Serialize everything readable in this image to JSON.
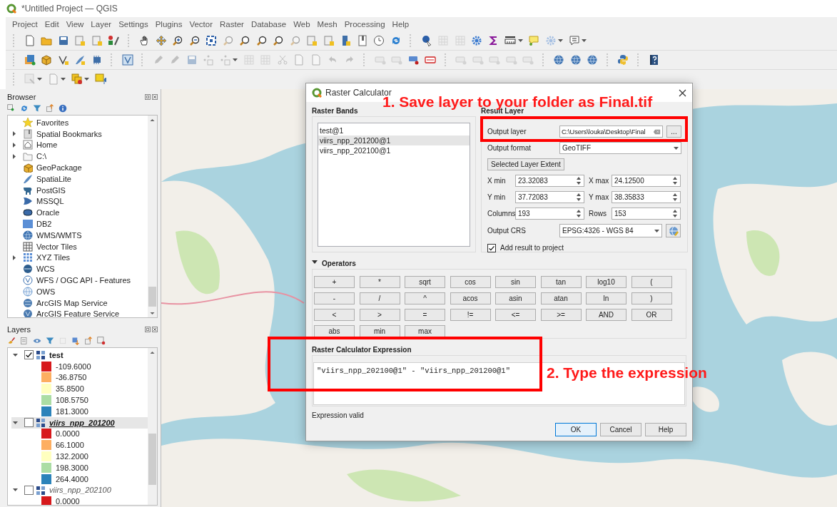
{
  "window": {
    "title": "*Untitled Project — QGIS"
  },
  "menu": [
    "Project",
    "Edit",
    "View",
    "Layer",
    "Settings",
    "Plugins",
    "Vector",
    "Raster",
    "Database",
    "Web",
    "Mesh",
    "Processing",
    "Help"
  ],
  "browser": {
    "title": "Browser",
    "items": [
      {
        "label": "Favorites",
        "kind": "leaf"
      },
      {
        "label": "Spatial Bookmarks",
        "kind": "group"
      },
      {
        "label": "Home",
        "kind": "group"
      },
      {
        "label": "C:\\",
        "kind": "group"
      },
      {
        "label": "GeoPackage",
        "kind": "leaf"
      },
      {
        "label": "SpatiaLite",
        "kind": "leaf"
      },
      {
        "label": "PostGIS",
        "kind": "leaf"
      },
      {
        "label": "MSSQL",
        "kind": "leaf"
      },
      {
        "label": "Oracle",
        "kind": "leaf"
      },
      {
        "label": "DB2",
        "kind": "leaf"
      },
      {
        "label": "WMS/WMTS",
        "kind": "leaf"
      },
      {
        "label": "Vector Tiles",
        "kind": "leaf"
      },
      {
        "label": "XYZ Tiles",
        "kind": "group"
      },
      {
        "label": "WCS",
        "kind": "leaf"
      },
      {
        "label": "WFS / OGC API - Features",
        "kind": "leaf"
      },
      {
        "label": "OWS",
        "kind": "leaf"
      },
      {
        "label": "ArcGIS Map Service",
        "kind": "leaf"
      },
      {
        "label": "ArcGIS Feature Service",
        "kind": "leaf"
      }
    ]
  },
  "layers": {
    "title": "Layers",
    "items": [
      {
        "name": "test",
        "checked": true,
        "expanded": true,
        "selected": false,
        "legend": [
          {
            "label": "-109.6000",
            "color": "#d7191c"
          },
          {
            "label": "-36.8750",
            "color": "#fdae61"
          },
          {
            "label": "35.8500",
            "color": "#ffffbf"
          },
          {
            "label": "108.5750",
            "color": "#abdda4"
          },
          {
            "label": "181.3000",
            "color": "#2b83ba"
          }
        ]
      },
      {
        "name": "viirs_npp_201200",
        "checked": false,
        "expanded": true,
        "selected": true,
        "legend": [
          {
            "label": "0.0000",
            "color": "#d7191c"
          },
          {
            "label": "66.1000",
            "color": "#fdae61"
          },
          {
            "label": "132.2000",
            "color": "#ffffbf"
          },
          {
            "label": "198.3000",
            "color": "#abdda4"
          },
          {
            "label": "264.4000",
            "color": "#2b83ba"
          }
        ]
      },
      {
        "name": "viirs_npp_202100",
        "checked": false,
        "expanded": true,
        "selected": false,
        "legend": [
          {
            "label": "0.0000",
            "color": "#d7191c"
          }
        ]
      }
    ]
  },
  "dialog": {
    "title": "Raster Calculator",
    "raster_bands": {
      "title": "Raster Bands",
      "items": [
        {
          "label": "test@1",
          "selected": false
        },
        {
          "label": "viirs_npp_201200@1",
          "selected": true
        },
        {
          "label": "viirs_npp_202100@1",
          "selected": false
        }
      ]
    },
    "result_layer": {
      "title": "Result Layer",
      "output_layer": {
        "label": "Output layer",
        "value": "C:\\Users\\louka\\Desktop\\Final",
        "browse": "..."
      },
      "output_format": {
        "label": "Output format",
        "value": "GeoTIFF"
      },
      "extent_button": "Selected Layer Extent",
      "fields": [
        {
          "label": "X min",
          "value": "23.32083"
        },
        {
          "label": "X max",
          "value": "24.12500"
        },
        {
          "label": "Y min",
          "value": "37.72083"
        },
        {
          "label": "Y max",
          "value": "38.35833"
        },
        {
          "label": "Columns",
          "value": "193"
        },
        {
          "label": "Rows",
          "value": "153"
        }
      ],
      "output_crs": {
        "label": "Output CRS",
        "value": "EPSG:4326 - WGS 84"
      },
      "add_to_project": {
        "label": "Add result to project",
        "checked": true
      }
    },
    "operators": {
      "title": "Operators",
      "expanded": true,
      "buttons": [
        "+",
        "*",
        "sqrt",
        "cos",
        "sin",
        "tan",
        "log10",
        "(",
        "-",
        "/",
        "^",
        "acos",
        "asin",
        "atan",
        "ln",
        ")",
        "<",
        ">",
        "=",
        "!=",
        "<=",
        ">=",
        "AND",
        "OR",
        "abs",
        "min",
        "max"
      ]
    },
    "expression": {
      "title": "Raster Calculator Expression",
      "value": "\"viirs_npp_202100@1\" - \"viirs_npp_201200@1\""
    },
    "status": "Expression valid",
    "buttons": [
      {
        "label": "OK",
        "default": true
      },
      {
        "label": "Cancel",
        "default": false
      },
      {
        "label": "Help",
        "default": false
      }
    ]
  },
  "annotations": [
    {
      "text": "1. Save layer to your folder as Final.tif"
    },
    {
      "text": "2. Type the expression"
    }
  ]
}
